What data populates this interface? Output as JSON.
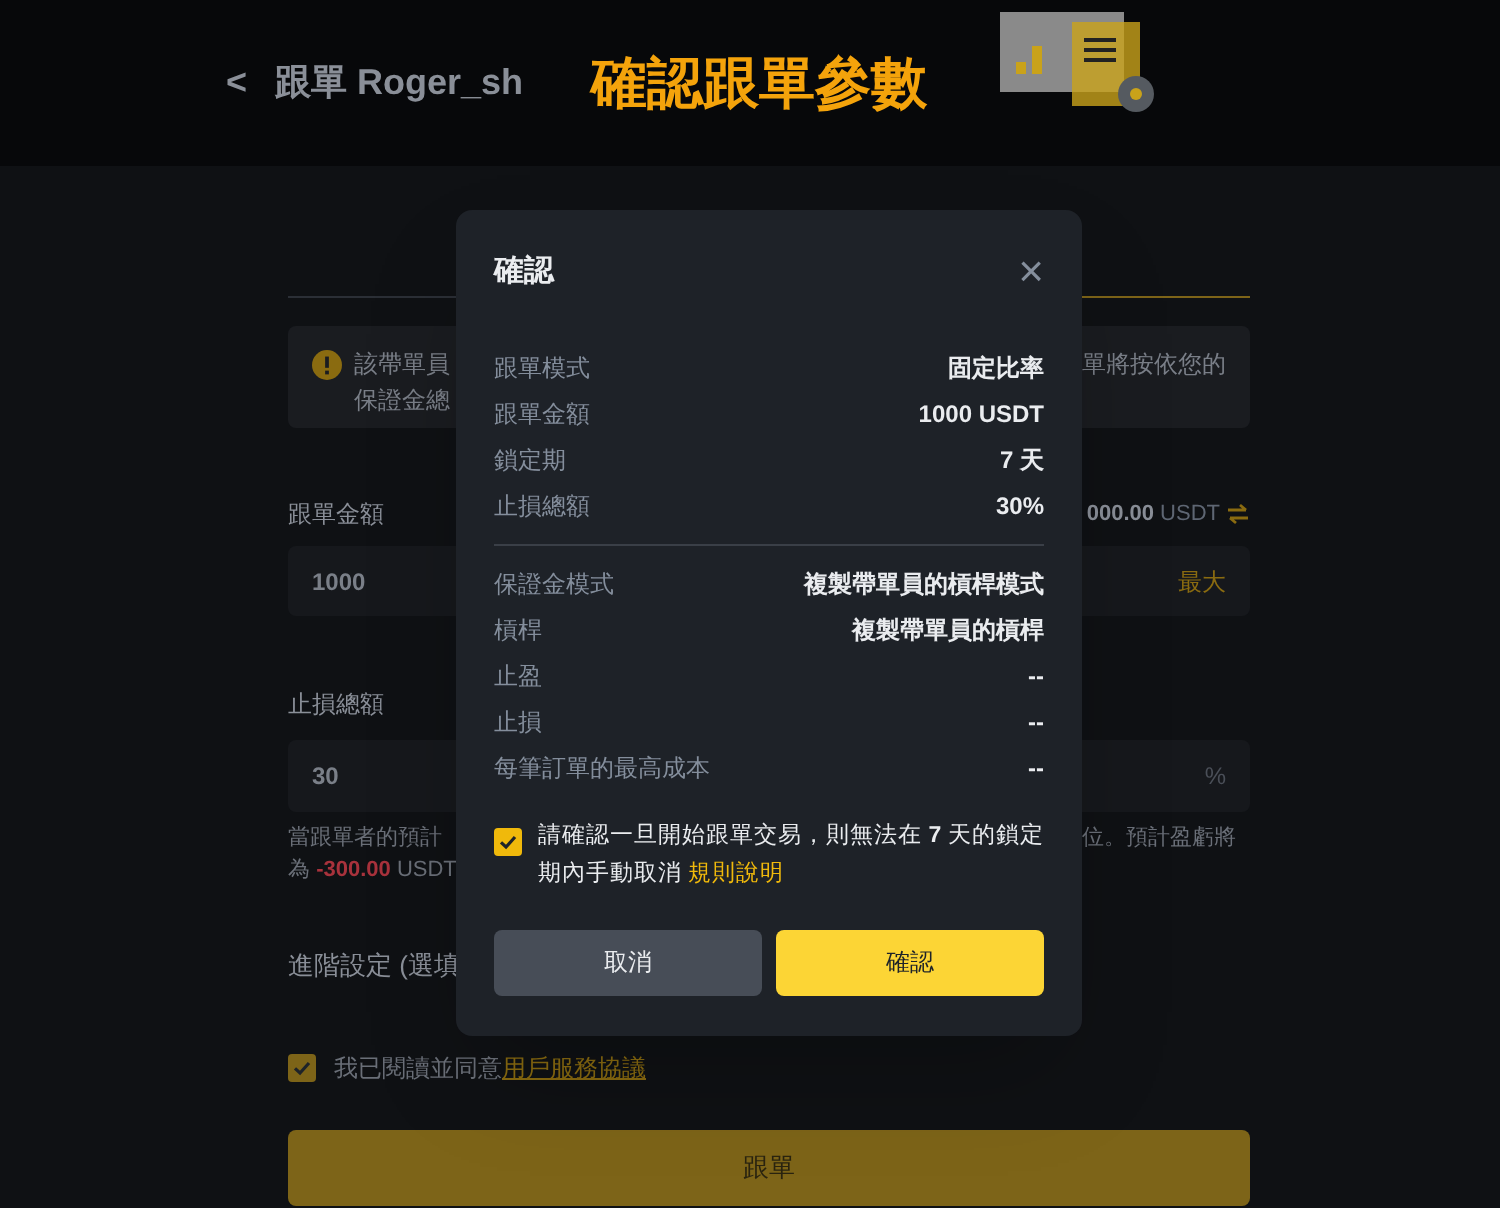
{
  "header": {
    "back": "<",
    "title": "跟單 Roger_sh",
    "annotation": "確認跟單參數"
  },
  "notice": {
    "left_lines": [
      "該帶單員",
      "保證金總"
    ],
    "right_lines": [
      "單將按依您的"
    ]
  },
  "amount": {
    "label": "跟單金額",
    "balance": "000.00",
    "unit": "USDT",
    "value": "1000",
    "max": "最大"
  },
  "stop_loss": {
    "label": "止損總額",
    "value": "30",
    "unit": "%",
    "hint_left": "當跟單者的預計",
    "hint_right": "位。預計盈虧將",
    "hint_prefix": "為",
    "hint_amount": "-300.00",
    "hint_unit": "USDT"
  },
  "advanced": {
    "label": "進階設定 (選填"
  },
  "agreement": {
    "checked": true,
    "text": "我已閱讀並同意",
    "link": "用戶服務協議"
  },
  "submit": "跟單",
  "dialog": {
    "title": "確認",
    "close": "×",
    "rows_1": [
      {
        "label": "跟單模式",
        "value": "固定比率"
      },
      {
        "label": "跟單金額",
        "value": "1000 USDT"
      },
      {
        "label": "鎖定期",
        "value": "7 天"
      },
      {
        "label": "止損總額",
        "value": "30%"
      }
    ],
    "rows_2": [
      {
        "label": "保證金模式",
        "value": "複製帶單員的槓桿模式"
      },
      {
        "label": "槓桿",
        "value": "複製帶單員的槓桿"
      },
      {
        "label": "止盈",
        "value": "--"
      },
      {
        "label": "止損",
        "value": "--"
      },
      {
        "label": "每筆訂單的最高成本",
        "value": "--"
      }
    ],
    "confirm": {
      "checked": true,
      "text": "請確認一旦開始跟單交易，則無法在 **7** 天的鎖定期內手動取消",
      "link": "規則說明"
    },
    "buttons": [
      "取消",
      "確認"
    ]
  }
}
